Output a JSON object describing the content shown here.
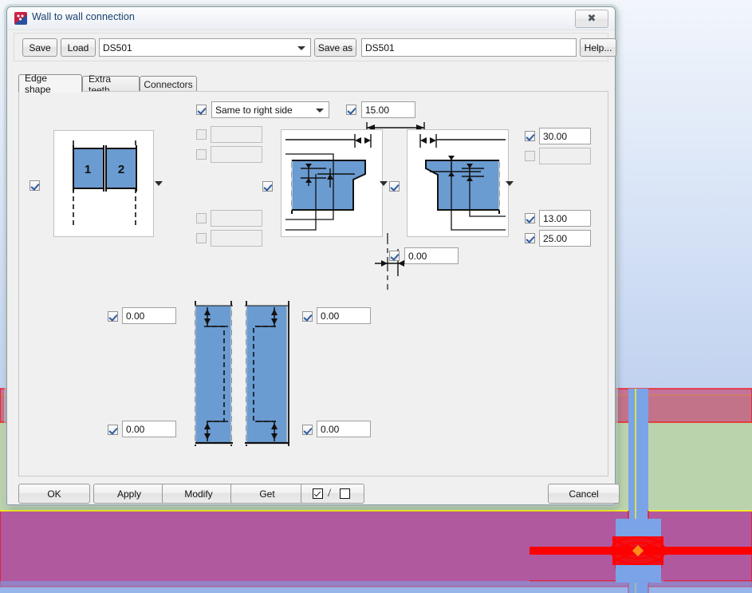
{
  "window": {
    "title": "Wall to wall connection",
    "icon": "tekla-app-icon",
    "close_label": "✖"
  },
  "toolbar": {
    "save_label": "Save",
    "load_label": "Load",
    "profile_combo_value": "DS501",
    "save_as_label": "Save as",
    "save_as_value": "DS501",
    "help_label": "Help..."
  },
  "tabs": [
    {
      "label": "Edge shape",
      "active": true
    },
    {
      "label": "Extra teeth",
      "active": false
    },
    {
      "label": "Connectors",
      "active": false
    }
  ],
  "panel": {
    "side_mode": {
      "checkbox": "checked",
      "value": "Same to right side",
      "options": [
        "Same to right side"
      ]
    },
    "top_value": {
      "checkbox": "checked",
      "value": "15.00"
    },
    "left_fields": [
      {
        "checkbox": "disabled",
        "value": ""
      },
      {
        "checkbox": "disabled",
        "value": ""
      },
      {
        "checkbox": "disabled",
        "value": ""
      },
      {
        "checkbox": "disabled",
        "value": ""
      }
    ],
    "right_fields": [
      {
        "checkbox": "checked",
        "value": "30.00"
      },
      {
        "checkbox": "disabled",
        "value": ""
      },
      {
        "checkbox": "checked",
        "value": "13.00"
      },
      {
        "checkbox": "checked",
        "value": "25.00"
      }
    ],
    "offset_field": {
      "checkbox": "checked",
      "value": "0.00"
    },
    "shape_selector_left": {
      "checkbox": "checked",
      "name": "left-edge-shape-picker"
    },
    "shape_selector_right": {
      "checkbox": "checked",
      "name": "right-edge-shape-picker"
    },
    "number_blocks": {
      "checkbox": "checked",
      "block_1": "1",
      "block_2": "2"
    },
    "bottom_fields": [
      {
        "checkbox": "checked",
        "value": "0.00",
        "name": "bottom-left-top-field"
      },
      {
        "checkbox": "checked",
        "value": "0.00",
        "name": "bottom-right-top-field"
      },
      {
        "checkbox": "checked",
        "value": "0.00",
        "name": "bottom-left-bottom-field"
      },
      {
        "checkbox": "checked",
        "value": "0.00",
        "name": "bottom-right-bottom-field"
      }
    ]
  },
  "footer": {
    "ok_label": "OK",
    "apply_label": "Apply",
    "modify_label": "Modify",
    "get_label": "Get",
    "toggle_label": "/",
    "cancel_label": "Cancel"
  },
  "colors": {
    "fill_blue": "#6a9bd1",
    "accent_checkmark": "#2d5ba4",
    "title_text": "#16406e",
    "cad_red": "#ff0000",
    "cad_magenta": "#b04f98",
    "cad_green": "#b8d3a8",
    "cad_blue": "#7ba3e8",
    "cad_yellow": "#ffff00",
    "cad_orange": "#ff8c1a"
  }
}
